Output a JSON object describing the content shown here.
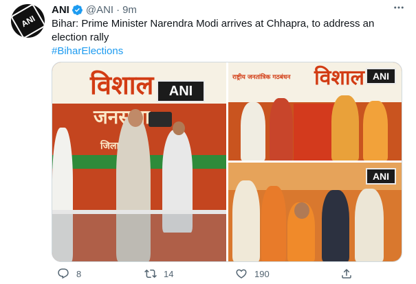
{
  "author": {
    "name": "ANI",
    "handle": "@ANI",
    "separator": "·",
    "time": "9m",
    "avatar_text": "ANI"
  },
  "tweet": {
    "text": "Bihar: Prime Minister Narendra Modi arrives at Chhapra, to address an election rally",
    "hashtag": "#BiharElections"
  },
  "media": {
    "watermark": "ANI",
    "left_banner_line1": "विशाल",
    "left_banner_line2": "जनसभा",
    "left_banner_line3": "जिला: छ",
    "tr_banner_small": "राष्ट्रीय जनतांत्रिक गठबंधन",
    "tr_banner_big": "विशाल"
  },
  "actions": {
    "reply_count": "8",
    "retweet_count": "14",
    "like_count": "190"
  },
  "colors": {
    "link": "#1d9bf0",
    "verified": "#1d9bf0",
    "muted": "#536471",
    "banner_orange": "#c4451f"
  },
  "icons": [
    "verified-badge-icon",
    "more-icon",
    "reply-icon",
    "retweet-icon",
    "like-icon",
    "share-icon"
  ]
}
